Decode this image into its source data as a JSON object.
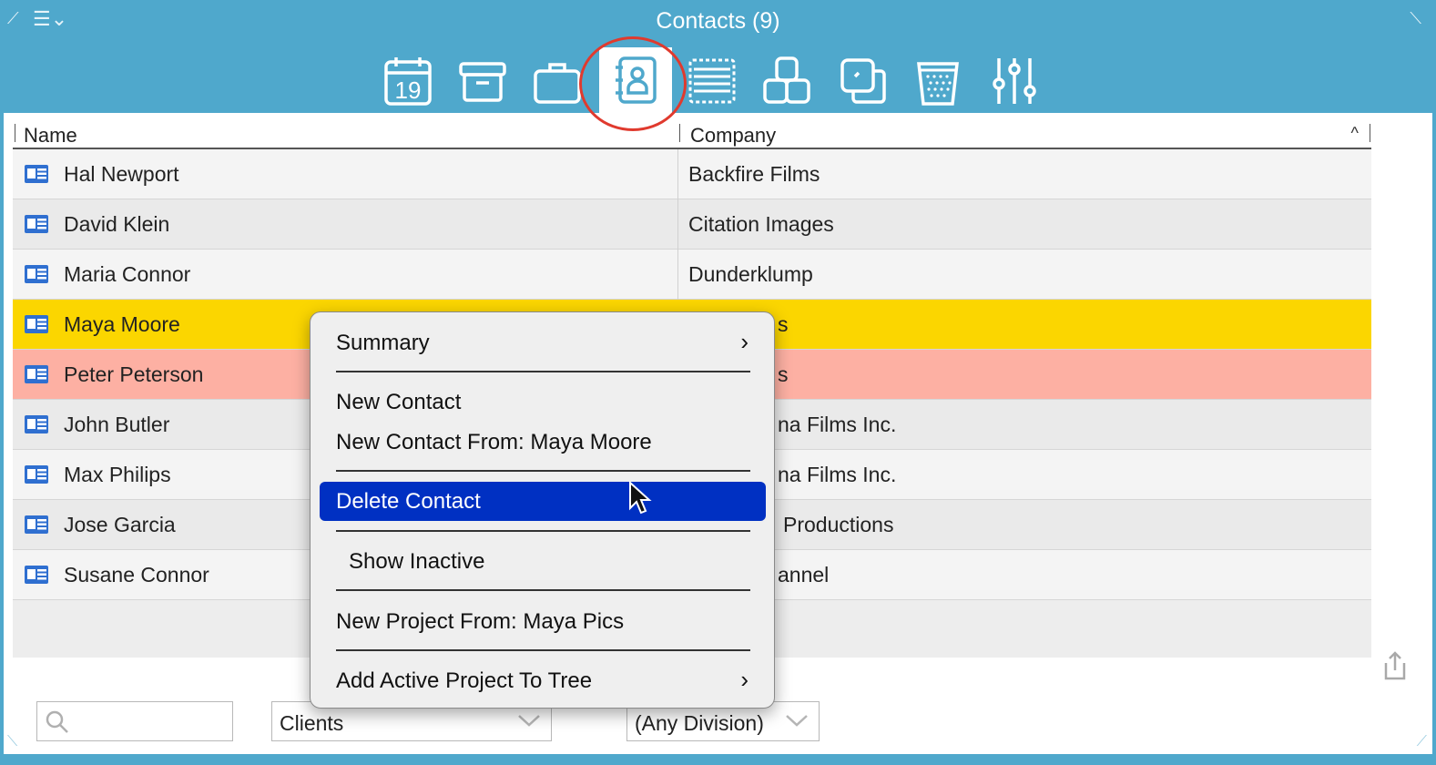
{
  "window": {
    "title": "Contacts (9)",
    "menu_control": "☰⌄",
    "colors": {
      "chrome": "#4fa8cc",
      "selection": "#fbd600",
      "warning_row": "#fdb0a3",
      "menu_highlight": "#0030c2",
      "annotation_ring": "#e03a2e"
    }
  },
  "toolbar": {
    "tools": [
      {
        "icon": "calendar-icon",
        "text": "19"
      },
      {
        "icon": "archive-box-icon"
      },
      {
        "icon": "briefcase-icon"
      },
      {
        "icon": "contacts-book-icon",
        "active": true
      },
      {
        "icon": "list-icon"
      },
      {
        "icon": "group-icon"
      },
      {
        "icon": "stacked-squares-icon"
      },
      {
        "icon": "trash-can-icon"
      },
      {
        "icon": "sliders-icon"
      }
    ]
  },
  "table": {
    "columns": [
      "Name",
      "Company"
    ],
    "rows": [
      {
        "name": "Hal Newport",
        "company": "Backfire Films"
      },
      {
        "name": "David Klein",
        "company": "Citation Images"
      },
      {
        "name": "Maria Connor",
        "company": "Dunderklump"
      },
      {
        "name": "Maya Moore",
        "company": "s",
        "state": "selected"
      },
      {
        "name": "Peter Peterson",
        "company": "s",
        "state": "warning"
      },
      {
        "name": "John Butler",
        "company": "na Films Inc."
      },
      {
        "name": "Max Philips",
        "company": "na Films Inc."
      },
      {
        "name": "Jose Garcia",
        "company": "Productions"
      },
      {
        "name": "Susane Connor",
        "company": "annel"
      }
    ]
  },
  "filters": {
    "search_placeholder": "",
    "category": "Clients",
    "division": "(Any Division)"
  },
  "context_menu": {
    "summary": "Summary",
    "new_contact": "New Contact",
    "new_contact_from": "New Contact From: Maya Moore",
    "delete_contact": "Delete Contact",
    "show_inactive": "Show Inactive",
    "new_project_from": "New Project From: Maya Pics",
    "add_active_project": "Add Active Project To Tree",
    "submenu_arrow": "›"
  }
}
